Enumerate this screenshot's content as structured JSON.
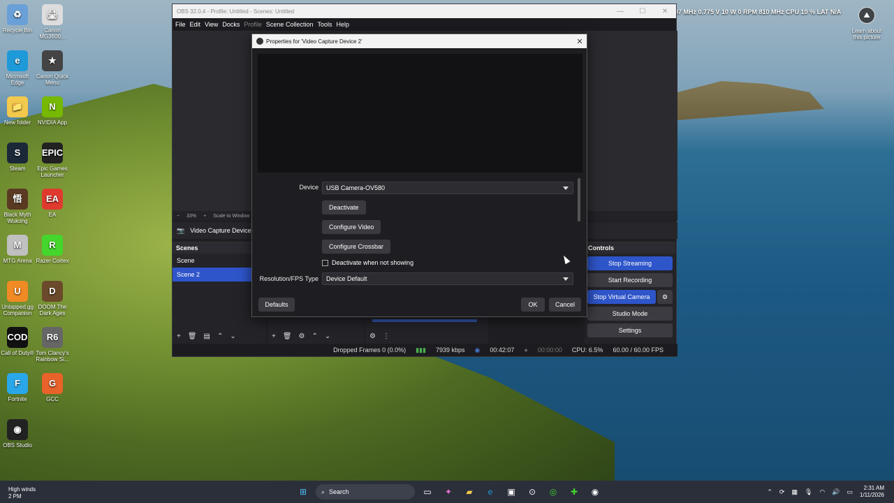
{
  "desktop": {
    "icons": [
      {
        "label": "Recycle Bin",
        "glyph": "♻",
        "color": "#6aa0d8"
      },
      {
        "label": "Canon MG3600...",
        "glyph": "🖨",
        "color": "#dddddd"
      },
      {
        "label": "Microsoft Edge",
        "glyph": "e",
        "color": "#1f9ad8"
      },
      {
        "label": "Canon Quick Menu",
        "glyph": "★",
        "color": "#444444"
      },
      {
        "label": "New folder",
        "glyph": "📁",
        "color": "#f2c94c"
      },
      {
        "label": "NVIDIA App",
        "glyph": "N",
        "color": "#76b900"
      },
      {
        "label": "Steam",
        "glyph": "S",
        "color": "#1b2838"
      },
      {
        "label": "Epic Games Launcher",
        "glyph": "EPIC",
        "color": "#222222"
      },
      {
        "label": "Black Myth Wukong",
        "glyph": "悟",
        "color": "#5a3a22"
      },
      {
        "label": "EA",
        "glyph": "EA",
        "color": "#e03a2e"
      },
      {
        "label": "MTG Arena",
        "glyph": "M",
        "color": "#c0c0c0"
      },
      {
        "label": "Razer Cortex",
        "glyph": "R",
        "color": "#44d62c"
      },
      {
        "label": "Untapped.gg Companion",
        "glyph": "U",
        "color": "#f08a24"
      },
      {
        "label": "DOOM The Dark Ages",
        "glyph": "D",
        "color": "#6a4a2a"
      },
      {
        "label": "Call of Duty®",
        "glyph": "COD",
        "color": "#111111"
      },
      {
        "label": "Tom Clancy's Rainbow Si...",
        "glyph": "R6",
        "color": "#666666"
      },
      {
        "label": "Fortnite",
        "glyph": "F",
        "color": "#2aa7e8"
      },
      {
        "label": "GCC",
        "glyph": "G",
        "color": "#e8622a"
      },
      {
        "label": "OBS Studio",
        "glyph": "◉",
        "color": "#222222"
      }
    ],
    "hw_stats": "07 MHz 0.775 V 10 W 0 RPM 810 MHz    CPU 10 %    LAT N/A",
    "learn_about": "Learn about this picture"
  },
  "obs": {
    "title": "OBS 32.0.4 - Profile: Untitled - Scenes: Untitled",
    "menu": [
      "File",
      "Edit",
      "View",
      "Docks",
      "Profile",
      "Scene Collection",
      "Tools",
      "Help"
    ],
    "zoom": {
      "minus": "−",
      "level": "33%",
      "plus": "+",
      "scale_label": "Scale to Window"
    },
    "source_label": "Video Capture Device 2",
    "scenes_header": "Scenes",
    "scenes": [
      "Scene",
      "Scene 2"
    ],
    "controls_header": "Controls",
    "controls": {
      "stop_streaming": "Stop Streaming",
      "start_recording": "Start Recording",
      "stop_virtual_camera": "Stop Virtual Camera",
      "studio_mode": "Studio Mode",
      "settings": "Settings"
    },
    "status": {
      "dropped_frames": "Dropped Frames 0 (0.0%)",
      "bitrate": "7939 kbps",
      "stream_time": "00:42:07",
      "rec_time": "00:00:00",
      "cpu": "CPU: 6.5%",
      "fps": "60.00 / 60.00 FPS"
    }
  },
  "dialog": {
    "title": "Properties for 'Video Capture Device 2'",
    "device_label": "Device",
    "device_value": "USB Camera-OV580",
    "deactivate": "Deactivate",
    "configure_video": "Configure Video",
    "configure_crossbar": "Configure Crossbar",
    "deactivate_when_not_showing": "Deactivate when not showing",
    "resolution_label": "Resolution/FPS Type",
    "resolution_value": "Device Default",
    "defaults": "Defaults",
    "ok": "OK",
    "cancel": "Cancel"
  },
  "taskbar": {
    "weather_title": "High winds",
    "weather_sub": "2 PM",
    "search_placeholder": "Search",
    "time": "2:31 AM",
    "date": "1/11/2026"
  }
}
